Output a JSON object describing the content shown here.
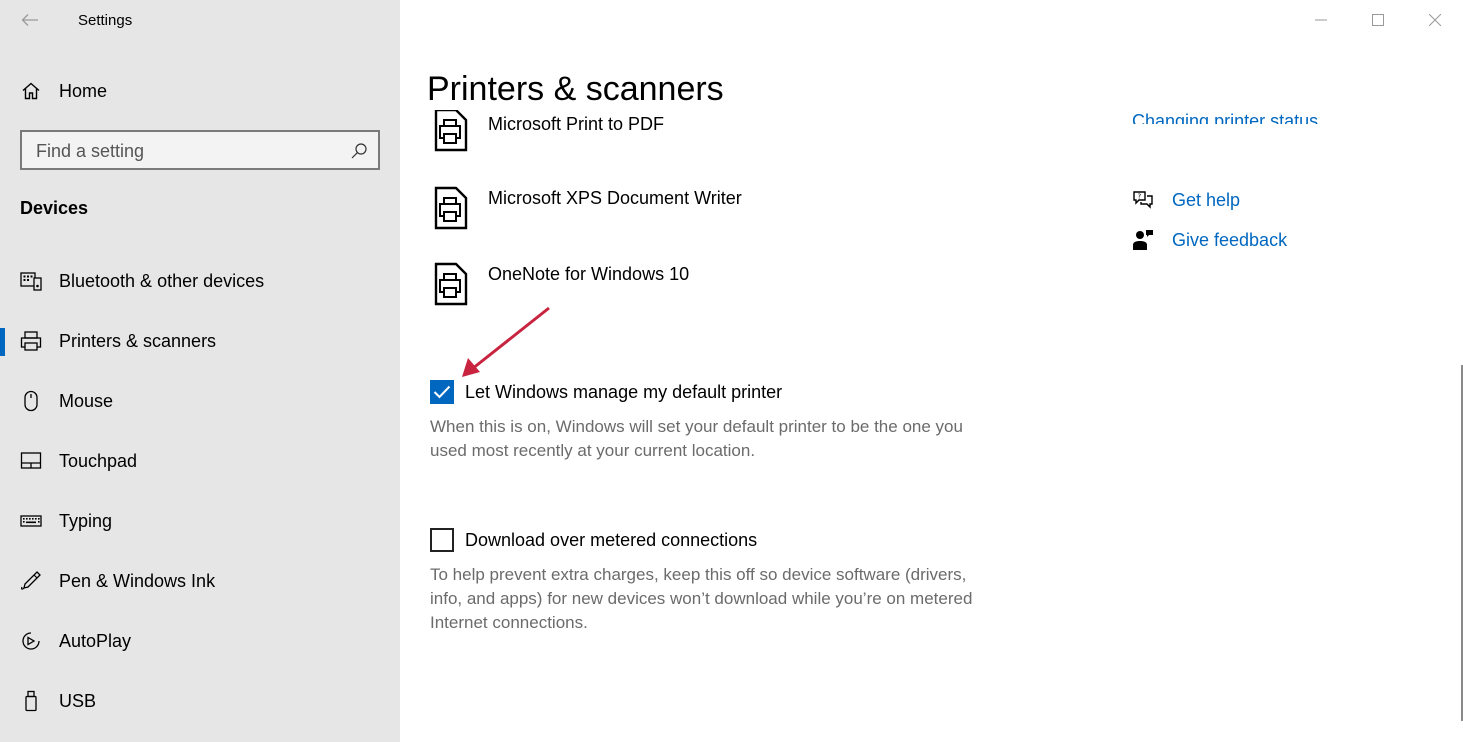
{
  "app": {
    "title": "Settings"
  },
  "sidebar": {
    "home_label": "Home",
    "search_placeholder": "Find a setting",
    "section_heading": "Devices",
    "items": [
      {
        "label": "Bluetooth & other devices",
        "icon": "bluetooth-devices-icon"
      },
      {
        "label": "Printers & scanners",
        "icon": "printer-icon",
        "selected": true
      },
      {
        "label": "Mouse",
        "icon": "mouse-icon"
      },
      {
        "label": "Touchpad",
        "icon": "touchpad-icon"
      },
      {
        "label": "Typing",
        "icon": "keyboard-icon"
      },
      {
        "label": "Pen & Windows Ink",
        "icon": "pen-icon"
      },
      {
        "label": "AutoPlay",
        "icon": "autoplay-icon"
      },
      {
        "label": "USB",
        "icon": "usb-icon"
      }
    ]
  },
  "main": {
    "title": "Printers & scanners",
    "printers": [
      {
        "name": "Microsoft Print to PDF"
      },
      {
        "name": "Microsoft XPS Document Writer"
      },
      {
        "name": "OneNote for Windows 10"
      }
    ],
    "options": [
      {
        "label": "Let Windows manage my default printer",
        "checked": true,
        "description": "When this is on, Windows will set your default printer to be the one you used most recently at your current location."
      },
      {
        "label": "Download over metered connections",
        "checked": false,
        "description": "To help prevent extra charges, keep this off so device software (drivers, info, and apps) for new devices won’t download while you’re on metered Internet connections."
      }
    ],
    "related": {
      "partial_link": "Changing printer status",
      "get_help": "Get help",
      "give_feedback": "Give feedback"
    }
  },
  "colors": {
    "accent": "#0067c0",
    "sidebar_bg": "#e6e6e6",
    "arrow": "#c8243f"
  }
}
